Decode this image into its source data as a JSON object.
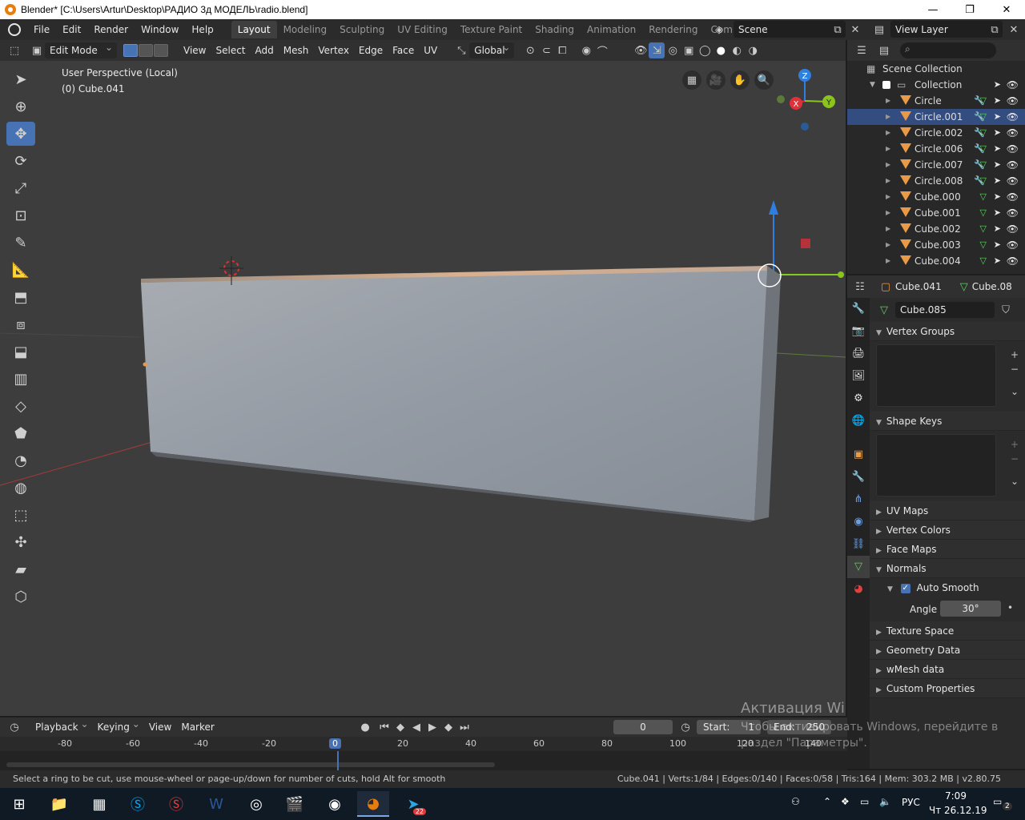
{
  "window": {
    "title": "Blender* [C:\\Users\\Artur\\Desktop\\РАДИО 3д МОДЕЛЬ\\radio.blend]",
    "min": "—",
    "max": "❐",
    "close": "✕"
  },
  "menu": [
    "File",
    "Edit",
    "Render",
    "Window",
    "Help"
  ],
  "workspaces": [
    "Layout",
    "Modeling",
    "Sculpting",
    "UV Editing",
    "Texture Paint",
    "Shading",
    "Animation",
    "Rendering",
    "Compositing"
  ],
  "active_workspace": "Layout",
  "scene": "Scene",
  "view_layer": "View Layer",
  "viewport_header": {
    "mode": "Edit Mode",
    "menus": [
      "View",
      "Select",
      "Add",
      "Mesh",
      "Vertex",
      "Edge",
      "Face",
      "UV"
    ],
    "transform_orientation": "Global"
  },
  "viewport": {
    "perspective_label": "User Perspective (Local)",
    "object_label": "(0) Cube.041",
    "gizmo": {
      "z": "Z",
      "x": "X",
      "y": "Y"
    }
  },
  "outliner": {
    "search_placeholder": "",
    "root": "Scene Collection",
    "collection": "Collection",
    "items": [
      {
        "name": "Circle",
        "type": "mesh",
        "selected": false
      },
      {
        "name": "Circle.001",
        "type": "mesh",
        "selected": true
      },
      {
        "name": "Circle.002",
        "type": "mesh",
        "selected": false
      },
      {
        "name": "Circle.006",
        "type": "mesh",
        "selected": false
      },
      {
        "name": "Circle.007",
        "type": "mesh",
        "selected": false
      },
      {
        "name": "Circle.008",
        "type": "mesh",
        "selected": false
      },
      {
        "name": "Cube.000",
        "type": "mesh",
        "selected": false
      },
      {
        "name": "Cube.001",
        "type": "mesh",
        "selected": false
      },
      {
        "name": "Cube.002",
        "type": "mesh",
        "selected": false
      },
      {
        "name": "Cube.003",
        "type": "mesh",
        "selected": false
      },
      {
        "name": "Cube.004",
        "type": "mesh",
        "selected": false
      }
    ]
  },
  "properties": {
    "object_name": "Cube.041",
    "data_name": "Cube.08",
    "mesh_name": "Cube.085",
    "panels": {
      "vertex_groups": "Vertex Groups",
      "shape_keys": "Shape Keys",
      "uv_maps": "UV Maps",
      "vertex_colors": "Vertex Colors",
      "face_maps": "Face Maps",
      "normals": "Normals",
      "auto_smooth": "Auto Smooth",
      "angle_label": "Angle",
      "angle_value": "30°",
      "texture_space": "Texture Space",
      "geometry_data": "Geometry Data",
      "wmesh_data": "wMesh data",
      "custom_properties": "Custom Properties"
    },
    "auto_smooth_checked": true
  },
  "timeline": {
    "menus": [
      "Playback",
      "Keying",
      "View",
      "Marker"
    ],
    "current_frame": "0",
    "start_label": "Start:",
    "start_value": "1",
    "end_label": "End:",
    "end_value": "250",
    "ticks": [
      "-80",
      "-60",
      "-40",
      "-20",
      "0",
      "20",
      "40",
      "60",
      "80",
      "100",
      "120",
      "140"
    ]
  },
  "watermark": {
    "line1": "Активация Windows",
    "line2": "Чтобы активировать Windows, перейдите в",
    "line3": "раздел \"Параметры\"."
  },
  "status": {
    "hint": "Select a ring to be cut, use mouse-wheel or page-up/down for number of cuts, hold Alt for smooth",
    "stats": "Cube.041 | Verts:1/84 | Edges:0/140 | Faces:0/58 | Tris:164 | Mem: 303.2 MB | v2.80.75"
  },
  "taskbar": {
    "lang": "РУС",
    "time": "7:09",
    "date": "Чт 26.12.19",
    "notif_count": "2",
    "telegram_badge": "22"
  },
  "colors": {
    "accent": "#4772b3",
    "selection_row": "#334d80",
    "mesh_icon": "#e89a47",
    "axis_x": "#e0303a",
    "axis_y": "#8bc41d",
    "axis_z": "#2f7fe0"
  }
}
